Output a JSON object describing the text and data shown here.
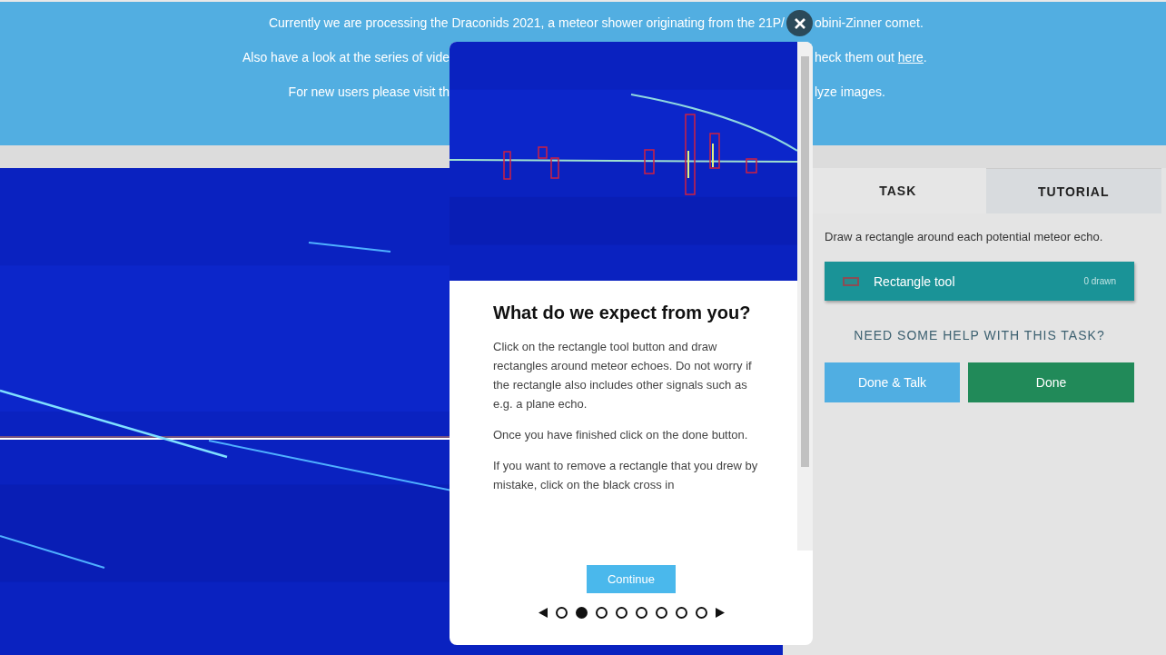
{
  "banner": {
    "line_1": {
      "left": "Currently we are processing the Draconids 2021, a meteor shower originating from the 21P/",
      "right": "obini-Zinner comet."
    },
    "line_2": {
      "left": "Also have a look at the series of vide",
      "right": "heck them out ",
      "link": "here",
      "end": "."
    },
    "line_3": {
      "left": "For new users please visit th",
      "right": "lyze images."
    }
  },
  "task_panel": {
    "tabs": [
      {
        "label": "TASK",
        "selected": true
      },
      {
        "label": "TUTORIAL",
        "selected": false
      }
    ],
    "instruction": "Draw a rectangle around each potential meteor echo.",
    "tool": {
      "label": "Rectangle tool",
      "count": "0 drawn"
    },
    "help": "NEED SOME HELP WITH THIS TASK?",
    "buttons": [
      {
        "label": "Done & Talk",
        "kind": "secondary"
      },
      {
        "label": "Done",
        "kind": "primary"
      }
    ]
  },
  "tutorial_modal": {
    "title": "What do we expect from you?",
    "paragraphs": [
      "Click on the rectangle tool button and draw rectangles around meteor echoes. Do not worry if the rectangle also includes other signals such as e.g. a plane echo.",
      "Once you have finished click on the done button.",
      "If you want to remove a rectangle that you drew by mistake, click on the black cross in"
    ],
    "continue": "Continue",
    "steps": [
      {
        "selected": false
      },
      {
        "selected": true
      },
      {
        "selected": false
      },
      {
        "selected": false
      },
      {
        "selected": false
      },
      {
        "selected": false
      },
      {
        "selected": false
      },
      {
        "selected": false
      }
    ]
  }
}
